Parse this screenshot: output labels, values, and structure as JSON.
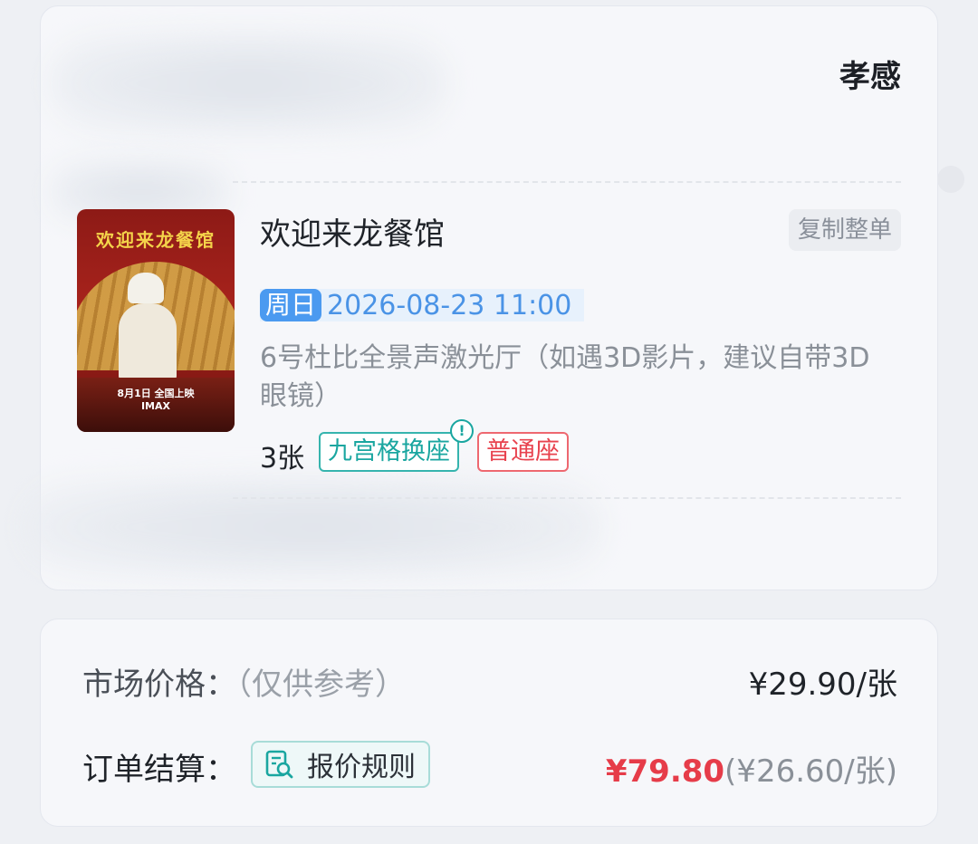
{
  "ticket": {
    "cinema_name": "孝感",
    "poster": {
      "title": "欢迎来龙餐馆",
      "release": "8月1日 全国上映",
      "format": "IMAX"
    },
    "movie_title": "欢迎来龙餐馆",
    "copy_button_label": "复制整单",
    "weekday": "周日",
    "datetime": "2026-08-23 11:00",
    "hall": "6号杜比全景声激光厅（如遇3D影片，建议自带3D眼镜）",
    "ticket_count": "3张",
    "tags": {
      "swap_seat": "九宫格换座",
      "seat_type": "普通座"
    },
    "info_badge": "!"
  },
  "pricing": {
    "market_label": "市场价格：",
    "market_note": "（仅供参考）",
    "market_value": "¥29.90/张",
    "settle_label": "订单结算：",
    "rules_button": "报价规则",
    "total": "¥79.80",
    "per_ticket": "(¥26.60/张)"
  },
  "colors": {
    "accent_blue": "#4b9af0",
    "teal": "#1aa6a0",
    "red": "#e63c49"
  },
  "icons": {
    "rules": "doc-search-icon",
    "info": "info-icon"
  }
}
